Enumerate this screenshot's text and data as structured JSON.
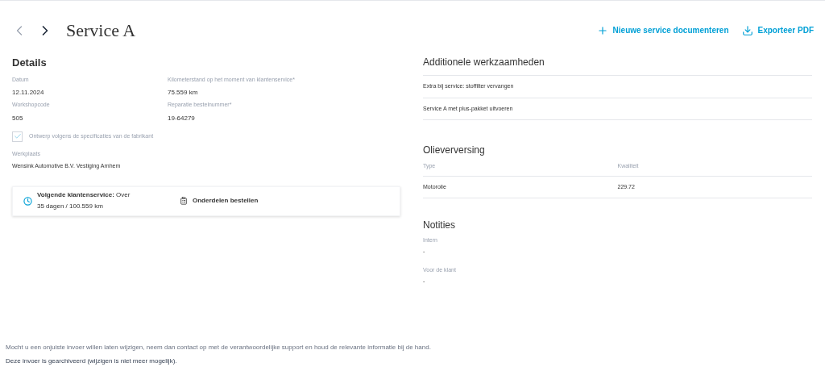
{
  "header": {
    "title": "Service A",
    "actions": [
      {
        "kind": "add",
        "label": "Nieuwe service documenteren"
      },
      {
        "kind": "download",
        "label": "Exporteer PDF"
      }
    ]
  },
  "details": {
    "heading": "Details",
    "fields": [
      {
        "label": "Datum",
        "value": "12.11.2024"
      },
      {
        "label": "Kilometerstand op het moment van klantenservice*",
        "value": "75.559 km"
      },
      {
        "label": "Workshopcode",
        "value": "505"
      },
      {
        "label": "Reparatie bestelnummer*",
        "value": "19-64279"
      }
    ],
    "checkbox": {
      "label": "Ontwerp volgens de specificaties van de fabrikant",
      "checked": true,
      "disabled": true
    },
    "workshop": {
      "label": "Werkplaats",
      "value": "Wensink Automotive B.V. Vestiging Arnhem"
    }
  },
  "next_service": {
    "text": "**Volgende klantenservice:** Over",
    "detail": "35 dagen / 100.559 km",
    "order_label": "Onderdelen bestellen"
  },
  "additional_work": {
    "heading": "Additionele werkzaamheden",
    "items": [
      "Extra bij service: stoffilter vervangen",
      "Service A met plus-pakket uitvoeren"
    ]
  },
  "oil_change": {
    "heading": "Olieverversing",
    "columns": [
      "Type",
      "Kwaliteit"
    ],
    "rows": [
      [
        "Motorolie",
        "229.72"
      ]
    ]
  },
  "notes": {
    "heading": "Notities",
    "fields": [
      {
        "label": "Intern",
        "value": "-"
      },
      {
        "label": "Voor de klant",
        "value": "-"
      }
    ]
  },
  "footer": {
    "notice": "Mocht u een onjuiste invoer willen laten wijzigen, neem dan contact op met de verantwoordelijke support en houd de relevante informatie bij de hand.",
    "archived": "Deze invoer is gearchiveerd (wijzigen is niet meer mogelijk)."
  }
}
